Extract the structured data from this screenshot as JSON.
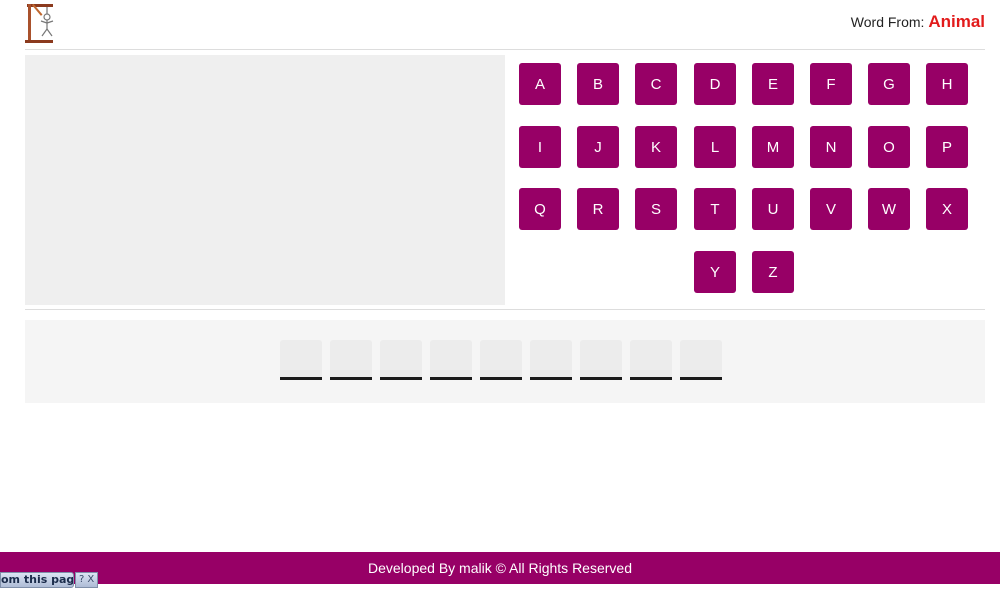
{
  "header": {
    "word_from_label": "Word From:",
    "category": "Animal",
    "logo_icon": "hangman-gallows-icon"
  },
  "keyboard": {
    "keys": [
      "A",
      "B",
      "C",
      "D",
      "E",
      "F",
      "G",
      "H",
      "I",
      "J",
      "K",
      "L",
      "M",
      "N",
      "O",
      "P",
      "Q",
      "R",
      "S",
      "T",
      "U",
      "V",
      "W",
      "X",
      "Y",
      "Z"
    ]
  },
  "word": {
    "slot_count": 9,
    "letters": [
      "",
      "",
      "",
      "",
      "",
      "",
      "",
      "",
      ""
    ]
  },
  "footer": {
    "text": "Developed By malik © All Rights Reserved"
  },
  "overlay": {
    "label": "om this page",
    "help_icon": "?",
    "close_icon": "X"
  },
  "colors": {
    "accent": "#970066",
    "category": "#e21b1b",
    "panel": "#efefef",
    "slot_underline": "#1b1b1b"
  }
}
